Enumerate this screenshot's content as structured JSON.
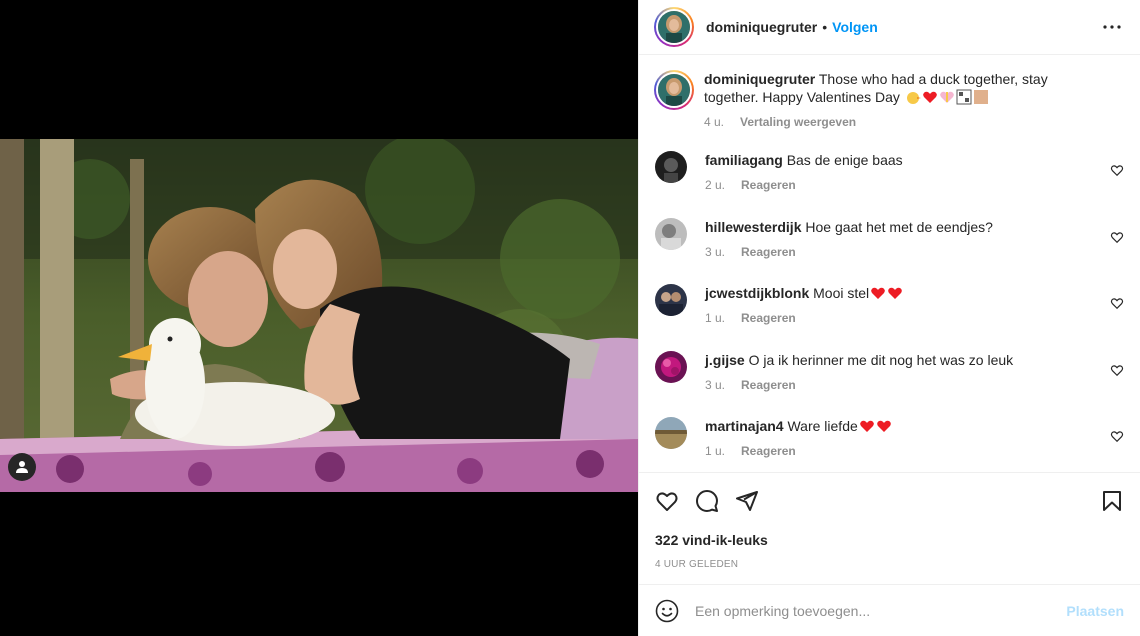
{
  "post": {
    "username": "dominiquegruter",
    "separator": "•",
    "follow_label": "Volgen",
    "caption_text": "Those who had a duck together, stay together. Happy Valentines Day",
    "caption_time": "4 u.",
    "caption_action": "Vertaling weergeven"
  },
  "comments": [
    {
      "user": "familiagang",
      "text": "Bas de enige baas",
      "time": "2 u.",
      "action": "Reageren",
      "avatar_color": "#3a3a3a"
    },
    {
      "user": "hillewesterdijk",
      "text": "Hoe gaat het met de eendjes?",
      "time": "3 u.",
      "action": "Reageren",
      "avatar_color": "#9a9a9a"
    },
    {
      "user": "jcwestdijkblonk",
      "text": "Mooi stel",
      "time": "1 u.",
      "action": "Reageren",
      "avatar_color": "#2d3448"
    },
    {
      "user": "j.gijse",
      "text": "O ja ik herinner me dit nog het was zo leuk",
      "time": "3 u.",
      "action": "Reageren",
      "avatar_color": "#8a1f6a"
    },
    {
      "user": "martinajan4",
      "text": "Ware liefde",
      "time": "1 u.",
      "action": "Reageren",
      "avatar_color": "#a38b5a"
    }
  ],
  "stats": {
    "likes": "322 vind-ik-leuks",
    "ago": "4 UUR GELEDEN"
  },
  "add_comment": {
    "placeholder": "Een opmerking toevoegen...",
    "post_label": "Plaatsen"
  },
  "icons": {
    "more": "more-horizontal-icon",
    "like": "heart-icon",
    "comment": "comment-icon",
    "share": "paper-plane-icon",
    "save": "bookmark-icon",
    "emoji": "smiley-icon",
    "tag": "user-tag-icon"
  },
  "colors": {
    "accent": "#0095f6",
    "muted": "#8e8e8e",
    "post_disabled": "#b2dffc",
    "heart_red": "#ed1c24"
  }
}
